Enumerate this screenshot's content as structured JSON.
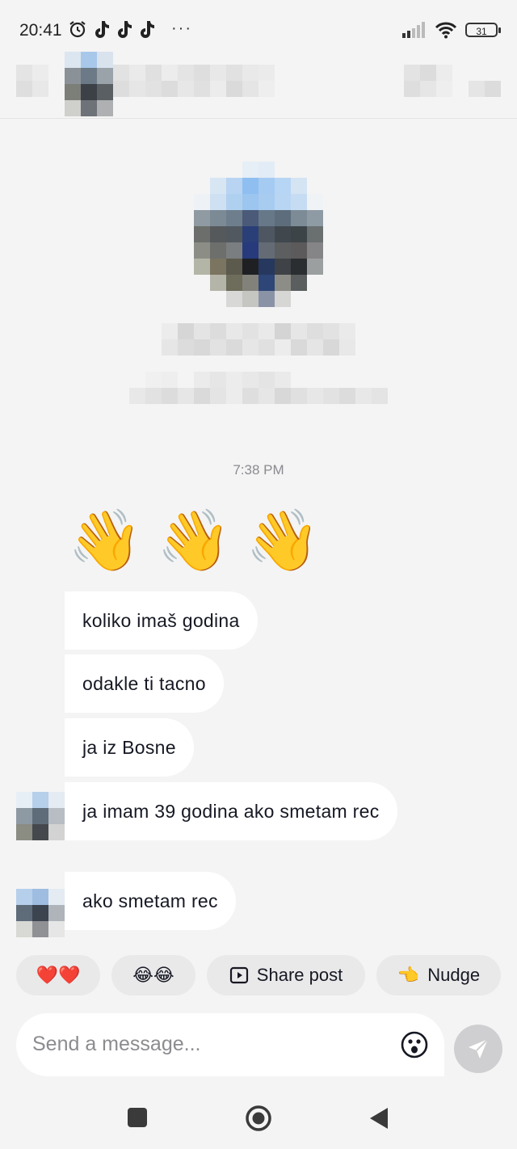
{
  "status_bar": {
    "time": "20:41",
    "more": "···",
    "battery": "31"
  },
  "conversation": {
    "timestamp": "7:38 PM",
    "wave_emojis": [
      "👋",
      "👋",
      "👋"
    ],
    "messages": [
      {
        "text": "koliko imaš godina"
      },
      {
        "text": "odakle ti tacno"
      },
      {
        "text": "ja iz Bosne"
      },
      {
        "text": "ja imam 39 godina ako smetam rec"
      },
      {
        "text": "ako smetam rec"
      }
    ]
  },
  "quick_replies": [
    {
      "label": "❤️❤️",
      "icon": ""
    },
    {
      "label": "😂😂",
      "icon": ""
    },
    {
      "label": "Share post",
      "icon": "share-post-icon"
    },
    {
      "label": "Nudge",
      "icon": "nudge-hand-icon"
    }
  ],
  "composer": {
    "placeholder": "Send a message..."
  },
  "colors": {
    "background": "#f4f4f4",
    "bubble": "#ffffff",
    "chip": "#e9e9ea",
    "send_button": "#cfcfd2"
  }
}
